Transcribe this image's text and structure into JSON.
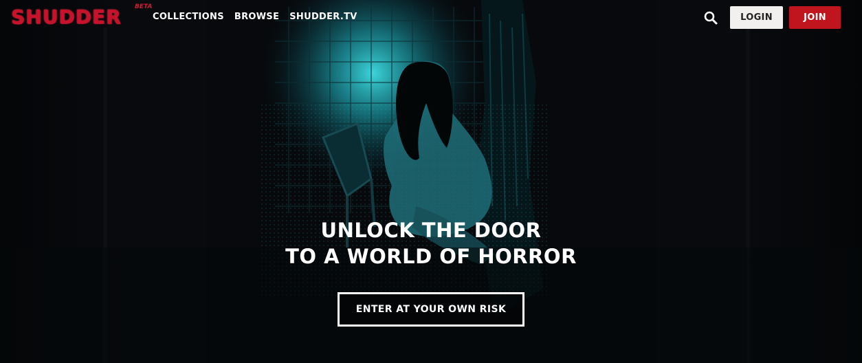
{
  "brand": {
    "logo_text": "SHUDDER",
    "badge": "BETA",
    "colors": {
      "logo": "#c8112a",
      "join": "#c0141f",
      "login_bg": "#f1f0ee",
      "accent_scene": "#29b6c4"
    }
  },
  "nav": {
    "items": [
      "COLLECTIONS",
      "BROWSE",
      "SHUDDER.TV"
    ]
  },
  "header": {
    "search_icon": "search-icon",
    "login_label": "LOGIN",
    "join_label": "JOIN"
  },
  "hero": {
    "headline_line1": "UNLOCK THE DOOR",
    "headline_line2": "TO A WORLD OF HORROR",
    "cta_label": "ENTER AT YOUR OWN RISK"
  }
}
